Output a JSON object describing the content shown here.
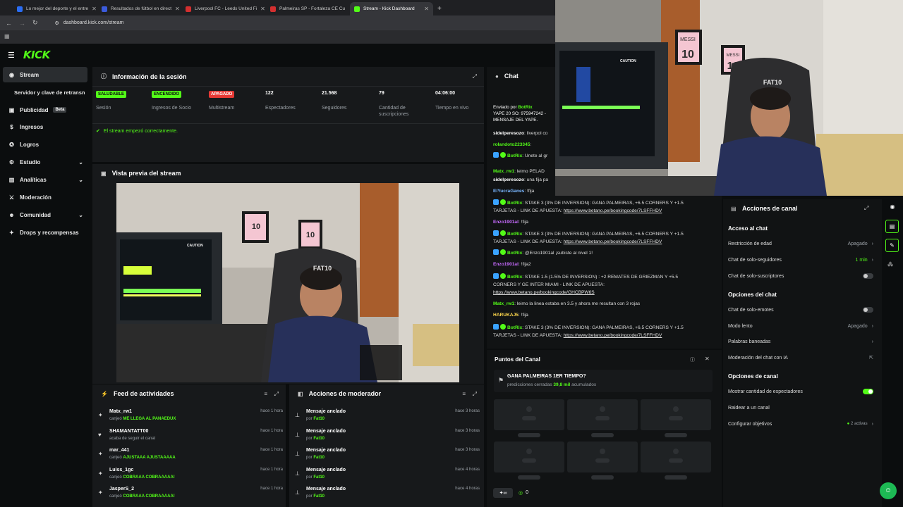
{
  "browser": {
    "tabs": [
      {
        "title": "Lo mejor del deporte y el entre",
        "color": "#2a6df4"
      },
      {
        "title": "Resultados de fútbol en direct",
        "color": "#3b5bdb"
      },
      {
        "title": "Liverpool FC - Leeds United Fi",
        "color": "#d32f2f"
      },
      {
        "title": "Palmeiras SP - Fortaleza CE Cu",
        "color": "#d32f2f"
      },
      {
        "title": "Stream - Kick Dashboard",
        "color": "#53fc18"
      }
    ],
    "url": "dashboard.kick.com/stream"
  },
  "brand": {
    "logo": "KICK",
    "accent": "#53fc18"
  },
  "sidebar": {
    "items": [
      {
        "label": "Stream"
      },
      {
        "label": "Servidor y clave de retransn"
      },
      {
        "label": "Publicidad",
        "badge": "Beta"
      },
      {
        "label": "Ingresos"
      },
      {
        "label": "Logros"
      },
      {
        "label": "Estudio"
      },
      {
        "label": "Analíticas"
      },
      {
        "label": "Moderación"
      },
      {
        "label": "Comunidad"
      },
      {
        "label": "Drops y recompensas"
      }
    ]
  },
  "session": {
    "title": "Información de la sesión",
    "stats": [
      {
        "value": "SALUDABLE",
        "label": "Sesión",
        "color": "#53fc18"
      },
      {
        "value": "ENCENDIDO",
        "label": "Ingresos de Socio",
        "color": "#53fc18"
      },
      {
        "value": "APAGADO",
        "label": "Multistream",
        "color": "#e53935"
      },
      {
        "value": "122",
        "label": "Espectadores"
      },
      {
        "value": "21.568",
        "label": "Seguidores"
      },
      {
        "value": "79",
        "label": "Cantidad de suscripciones"
      },
      {
        "value": "04:06:00",
        "label": "Tiempo en vivo"
      }
    ],
    "status_msg": "El stream empezó correctamente."
  },
  "preview": {
    "title": "Vista previa del stream"
  },
  "feed": {
    "title": "Feed de actividades",
    "rows": [
      {
        "name": "Matx_rw1",
        "sub": "canjeó",
        "hl": "ME LLEGA AL PANAEDUX",
        "time": "hace 1 hora",
        "icon": "gift-icon"
      },
      {
        "name": "SHAMANTATT00",
        "sub": "acaba de seguir el canal",
        "hl": "",
        "time": "hace 1 hora",
        "icon": "heart-icon"
      },
      {
        "name": "mar_441",
        "sub": "canjeó",
        "hl": "AJUSTAAA AJUSTAAAAA",
        "time": "hace 1 hora",
        "icon": "gift-icon"
      },
      {
        "name": "Luiss_1gc",
        "sub": "canjeó",
        "hl": "COBRAAA COBRAAAAA!",
        "time": "hace 1 hora",
        "icon": "gift-icon"
      },
      {
        "name": "JasperS_2",
        "sub": "canjeó",
        "hl": "COBRAAA COBRAAAAA!",
        "time": "hace 1 hora",
        "icon": "gift-icon"
      }
    ]
  },
  "mod": {
    "title": "Acciones de moderador",
    "rows": [
      {
        "name": "Mensaje anclado",
        "by": "por",
        "who": "Fat10",
        "time": "hace 3 horas"
      },
      {
        "name": "Mensaje anclado",
        "by": "por",
        "who": "Fat10",
        "time": "hace 3 horas"
      },
      {
        "name": "Mensaje anclado",
        "by": "por",
        "who": "Fat10",
        "time": "hace 3 horas"
      },
      {
        "name": "Mensaje anclado",
        "by": "por",
        "who": "Fat10",
        "time": "hace 4 horas"
      },
      {
        "name": "Mensaje anclado",
        "by": "por",
        "who": "Fat10",
        "time": "hace 4 horas"
      }
    ]
  },
  "chat": {
    "title": "Chat",
    "pinned": {
      "label": "Enviado por",
      "user": "BotRix",
      "text": "YAPE 20 SO: 975947242 - MENSAJE DEL YAPE."
    },
    "messages": [
      {
        "user": "sidelperesozo",
        "color": "#ffffff",
        "text": "liverpol co",
        "bot": false
      },
      {
        "user": "rolandoto223345",
        "color": "#53fc18",
        "text": "",
        "bot": false
      },
      {
        "user": "BotRix",
        "color": "#53fc18",
        "text": "Unete al gr",
        "bot": true
      },
      {
        "user": "Matx_rw1",
        "color": "#53fc18",
        "text": "leimo PELAD",
        "bot": false
      },
      {
        "user": "sidelperesozo",
        "color": "#ffffff",
        "text": "una fija pa",
        "bot": false
      },
      {
        "user": "ElYucraGanes",
        "color": "#7ab7ff",
        "text": "!fija",
        "bot": false
      },
      {
        "user": "BotRix",
        "color": "#53fc18",
        "text": "STAKE 3 (3% DE INVERSION): GANA PALMEIRAS, +6.5 CORNERS Y +1.5 TARJETAS - LINK DE APUESTA:",
        "link": "https://www.betano.pe/bookingcode/7LSFFHDV",
        "bot": true
      },
      {
        "user": "Enzo1901al",
        "color": "#c86bff",
        "text": "!fija",
        "bot": false
      },
      {
        "user": "BotRix",
        "color": "#53fc18",
        "text": "STAKE 3 (3% DE INVERSION): GANA PALMEIRAS, +6.5 CORNERS Y +1.5 TARJETAS - LINK DE APUESTA:",
        "link": "https://www.betano.pe/bookingcode/7LSFFHDV",
        "bot": true
      },
      {
        "user": "BotRix",
        "color": "#53fc18",
        "text": "@Enzo1901al ¡subiste al nivel 1!",
        "bot": true
      },
      {
        "user": "Enzo1901al",
        "color": "#c86bff",
        "text": "!fija2",
        "bot": false
      },
      {
        "user": "BotRix",
        "color": "#53fc18",
        "text": "STAKE 1.5 (1.5% DE INVERSION) : +2 REMATES DE GRIEZMAN Y +5.5 CORNERS Y GE INTER MIAMI - LINK DE APUESTA:",
        "link": "https://www.betano.pe/bookingcode/GHCBPW6S",
        "bot": true
      },
      {
        "user": "Matx_rw1",
        "color": "#53fc18",
        "text": "leimo la linea estaba en 3.5 y ahora me resultan con 3 rojas",
        "bot": false
      },
      {
        "user": "HARUKAJ5",
        "color": "#ffd84d",
        "text": "!fija",
        "bot": false
      },
      {
        "user": "BotRix",
        "color": "#53fc18",
        "text": "STAKE 3 (3% DE INVERSION): GANA PALMEIRAS, +6.5 CORNERS Y +1.5 TARJETAS - LINK DE APUESTA:",
        "link": "https://www.betano.pe/bookingcode/7LSFFHDV",
        "bot": true
      }
    ]
  },
  "points": {
    "title": "Puntos del Canal",
    "prediction": "GANA PALMEIRAS 1ER TIEMPO?",
    "pred_status": "predicciones cerradas",
    "pred_amount": "39,8 mil",
    "pred_suffix": "acumulados",
    "footer_count": "0"
  },
  "actions": {
    "title": "Acciones de canal",
    "access_h": "Acceso al chat",
    "age": "Restricción de edad",
    "age_v": "Apagado",
    "followers": "Chat de solo-seguidores",
    "followers_v": "1 min",
    "subs": "Chat de solo-suscriptores",
    "chat_h": "Opciones del chat",
    "emotes": "Chat de solo-emotes",
    "slow": "Modo lento",
    "slow_v": "Apagado",
    "banned": "Palabras baneadas",
    "ai": "Moderación del chat con IA",
    "channel_h": "Opciones de canal",
    "viewers": "Mostrar cantidad de espectadores",
    "raid": "Raidear a un canal",
    "goals": "Configurar objetivos",
    "goals_v": "2 activas"
  },
  "overlay": {
    "name_tag": "FAT10",
    "jersey": "MESSI",
    "number": "10",
    "caution": "CAUTION"
  }
}
